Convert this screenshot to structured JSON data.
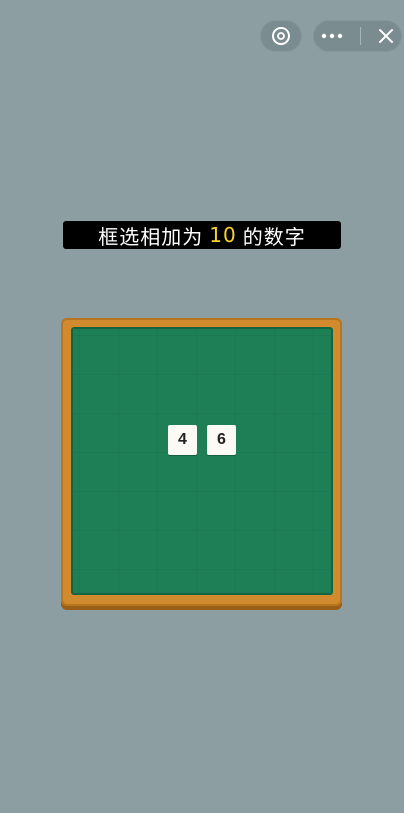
{
  "topbar": {
    "game_icon": "pacman-circle-icon",
    "more_icon": "more-dots-icon",
    "close_icon": "close-icon"
  },
  "instruction": {
    "prefix": "框选相加为",
    "target": "10",
    "suffix": "的数字"
  },
  "board": {
    "tiles": [
      "4",
      "6"
    ]
  },
  "colors": {
    "background": "#8d9ea3",
    "board_green": "#1e7f57",
    "frame_wood": "#d18a2d",
    "highlight": "#f6d22a"
  }
}
